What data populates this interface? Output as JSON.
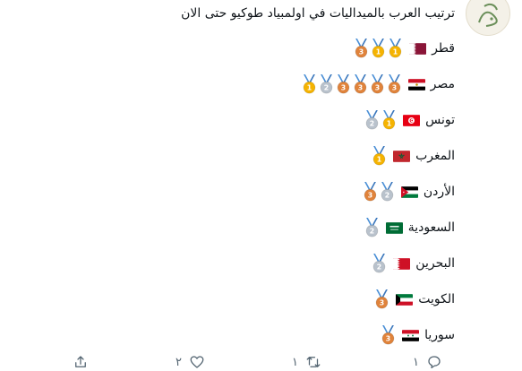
{
  "tweet": {
    "title": "ترتيب العرب بالميداليات في اولمبياد طوكيو حتى الان",
    "rows": [
      {
        "country": "قطر",
        "flag": "qa",
        "medals": [
          "gold",
          "gold",
          "bronze"
        ]
      },
      {
        "country": "مصر",
        "flag": "eg",
        "medals": [
          "bronze",
          "bronze",
          "bronze",
          "bronze",
          "silver",
          "gold"
        ]
      },
      {
        "country": "تونس",
        "flag": "tn",
        "medals": [
          "gold",
          "silver"
        ]
      },
      {
        "country": "المغرب",
        "flag": "ma",
        "medals": [
          "gold"
        ]
      },
      {
        "country": "الأردن",
        "flag": "jo",
        "medals": [
          "silver",
          "bronze"
        ]
      },
      {
        "country": "السعودية",
        "flag": "sa",
        "medals": [
          "silver"
        ]
      },
      {
        "country": "البحرين",
        "flag": "bh",
        "medals": [
          "silver"
        ]
      },
      {
        "country": "الكويت",
        "flag": "kw",
        "medals": [
          "bronze"
        ]
      },
      {
        "country": "سوريا",
        "flag": "sy",
        "medals": [
          "bronze"
        ]
      }
    ]
  },
  "actions": {
    "reply_count": "١",
    "retweet_count": "١",
    "like_count": "٢"
  },
  "colors": {
    "gold": "#f5b301",
    "silver": "#b9c2cc",
    "bronze": "#e0833b",
    "ribbon": "#4a8fd6",
    "icon": "#536471"
  }
}
